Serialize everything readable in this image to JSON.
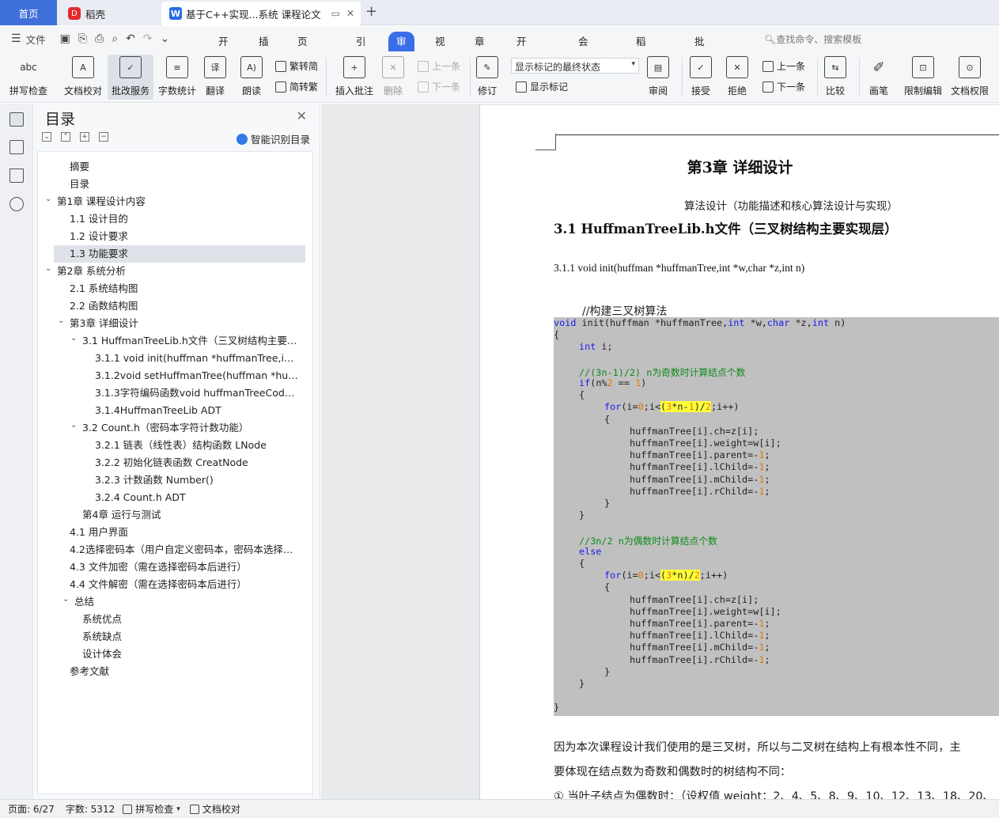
{
  "tabs": {
    "home": "首页",
    "daoke": "稻壳",
    "doc": "基于C++实现...系统 课程论文",
    "new_tab": "+"
  },
  "menu": {
    "file": "文件",
    "items": [
      "开始",
      "插入",
      "页面布局",
      "引用",
      "审阅",
      "视图",
      "章节",
      "开发工具",
      "会员专享",
      "稻壳资源",
      "批改服务"
    ],
    "active": "审阅",
    "search": "查找命令、搜索模板"
  },
  "ribbon": {
    "spell": "拼写检查",
    "doccheck": "文档校对",
    "correct": "批改服务",
    "wordcount": "字数统计",
    "translate": "翻译",
    "read": "朗读",
    "t2s": "繁转简",
    "s2t": "简转繁",
    "insert_comment": "插入批注",
    "delete": "删除",
    "prev_c": "上一条",
    "next_c": "下一条",
    "revise": "修订",
    "markup_state": "显示标记的最终状态",
    "show_markup": "显示标记",
    "review": "审阅",
    "accept": "接受",
    "reject": "拒绝",
    "prev": "上一条",
    "next": "下一条",
    "compare": "比较",
    "pen": "画笔",
    "restrict": "限制编辑",
    "permission": "文档权限"
  },
  "toc": {
    "title": "目录",
    "smart": "智能识别目录",
    "selected": "1.3 功能要求",
    "items": [
      {
        "text": "摘要",
        "level": 1,
        "caret": ""
      },
      {
        "text": "目录",
        "level": 1,
        "caret": ""
      },
      {
        "text": "第1章 课程设计内容",
        "level": 0,
        "caret": "v"
      },
      {
        "text": "1.1 设计目的",
        "level": 1,
        "caret": ""
      },
      {
        "text": "1.2 设计要求",
        "level": 1,
        "caret": ""
      },
      {
        "text": "1.3 功能要求",
        "level": 1,
        "caret": ""
      },
      {
        "text": "第2章 系统分析",
        "level": 0,
        "caret": "v"
      },
      {
        "text": "2.1 系统结构图",
        "level": 1,
        "caret": ""
      },
      {
        "text": "2.2 函数结构图",
        "level": 1,
        "caret": ""
      },
      {
        "text": "第3章 详细设计",
        "level": 1,
        "caret": "v"
      },
      {
        "text": "3.1 HuffmanTreeLib.h文件（三叉树结构主要实…",
        "level": 2,
        "caret": "v"
      },
      {
        "text": "3.1.1 void init(huffman *huffmanTree,int * …",
        "level": 3,
        "caret": ""
      },
      {
        "text": "3.1.2void setHuffmanTree(huffman *huffm…",
        "level": 3,
        "caret": ""
      },
      {
        "text": "3.1.3字符编码函数void huffmanTreeCode(h…",
        "level": 3,
        "caret": ""
      },
      {
        "text": "3.1.4HuffmanTreeLib ADT",
        "level": 3,
        "caret": ""
      },
      {
        "text": "3.2 Count.h（密码本字符计数功能）",
        "level": 2,
        "caret": "v"
      },
      {
        "text": "3.2.1 链表（线性表）结构函数 LNode",
        "level": 3,
        "caret": ""
      },
      {
        "text": "3.2.2 初始化链表函数 CreatNode",
        "level": 3,
        "caret": ""
      },
      {
        "text": "3.2.3 计数函数 Number()",
        "level": 3,
        "caret": ""
      },
      {
        "text": "3.2.4 Count.h ADT",
        "level": 3,
        "caret": ""
      },
      {
        "text": "第4章 运行与测试",
        "level": 2,
        "caret": ""
      },
      {
        "text": "4.1 用户界面",
        "level": 1,
        "caret": ""
      },
      {
        "text": "4.2选择密码本（用户自定义密码本，密码本选择不…",
        "level": 1,
        "caret": ""
      },
      {
        "text": "4.3 文件加密（需在选择密码本后进行）",
        "level": 1,
        "caret": ""
      },
      {
        "text": "4.4 文件解密（需在选择密码本后进行）",
        "level": 1,
        "caret": ""
      },
      {
        "text": "总结",
        "level": 1,
        "caret": "v"
      },
      {
        "text": "系统优点",
        "level": 2,
        "caret": ""
      },
      {
        "text": "系统缺点",
        "level": 2,
        "caret": ""
      },
      {
        "text": "设计体会",
        "level": 2,
        "caret": ""
      },
      {
        "text": "参考文献",
        "level": 1,
        "caret": ""
      }
    ]
  },
  "doc": {
    "chapter": "第3章 详细设计",
    "subtitle": "算法设计（功能描述和核心算法设计与实现）",
    "h2": "3.1 HuffmanTreeLib.h文件（三叉树结构主要实现层）",
    "h3": "3.1.1 void init(huffman *huffmanTree,int *w,char *z,int n)",
    "comment_line": "//构建三叉树算法",
    "code": [
      {
        "i": 0,
        "t": "<span class=\"kw\">void</span> init(huffman *huffmanTree,<span class=\"kw\">int</span> *w,<span class=\"kw\">char</span> *z,<span class=\"kw\">int</span> n)"
      },
      {
        "i": 0,
        "t": "{"
      },
      {
        "i": 1,
        "t": "<span class=\"kw\">int</span> i;"
      },
      {
        "i": 1,
        "t": ""
      },
      {
        "i": 1,
        "t": "<span class=\"cm\">//(3n-1)/2) n为奇数时计算结点个数</span>"
      },
      {
        "i": 1,
        "t": "<span class=\"kw\">if</span>(n%<span class=\"nm\">2</span> == <span class=\"nm\">1</span>)"
      },
      {
        "i": 1,
        "t": "{"
      },
      {
        "i": 2,
        "t": "<span class=\"kw\">for</span>(i=<span class=\"nm\">0</span>;i&lt;<span class=\"hl\">(<span class=\"nm\">3</span>*n-<span class=\"nm\">1</span>)/<span class=\"nm\">2</span></span>;i++)"
      },
      {
        "i": 2,
        "t": "{"
      },
      {
        "i": 3,
        "t": "huffmanTree[i].ch=z[i];"
      },
      {
        "i": 3,
        "t": "huffmanTree[i].weight=w[i];"
      },
      {
        "i": 3,
        "t": "huffmanTree[i].parent=-<span class=\"nm\">1</span>;"
      },
      {
        "i": 3,
        "t": "huffmanTree[i].lChild=-<span class=\"nm\">1</span>;"
      },
      {
        "i": 3,
        "t": "huffmanTree[i].mChild=-<span class=\"nm\">1</span>;"
      },
      {
        "i": 3,
        "t": "huffmanTree[i].rChild=-<span class=\"nm\">1</span>;"
      },
      {
        "i": 2,
        "t": "}"
      },
      {
        "i": 1,
        "t": "}"
      },
      {
        "i": 1,
        "t": ""
      },
      {
        "i": 1,
        "t": "<span class=\"cm\">//3n/2 n为偶数时计算结点个数</span>"
      },
      {
        "i": 1,
        "t": "<span class=\"kw\">else</span>"
      },
      {
        "i": 1,
        "t": "{"
      },
      {
        "i": 2,
        "t": "<span class=\"kw\">for</span>(i=<span class=\"nm\">0</span>;i&lt;<span class=\"hl\">(<span class=\"nm\">3</span>*n)/<span class=\"nm\">2</span></span>;i++)"
      },
      {
        "i": 2,
        "t": "{"
      },
      {
        "i": 3,
        "t": "huffmanTree[i].ch=z[i];"
      },
      {
        "i": 3,
        "t": "huffmanTree[i].weight=w[i];"
      },
      {
        "i": 3,
        "t": "huffmanTree[i].parent=-<span class=\"nm\">1</span>;"
      },
      {
        "i": 3,
        "t": "huffmanTree[i].lChild=-<span class=\"nm\">1</span>;"
      },
      {
        "i": 3,
        "t": "huffmanTree[i].mChild=-<span class=\"nm\">1</span>;"
      },
      {
        "i": 3,
        "t": "huffmanTree[i].rChild=-<span class=\"nm\">1</span>;"
      },
      {
        "i": 2,
        "t": "}"
      },
      {
        "i": 1,
        "t": "}"
      },
      {
        "i": 0,
        "t": ""
      },
      {
        "i": 0,
        "t": "}"
      }
    ],
    "para1": "因为本次课程设计我们使用的是三叉树，所以与二叉树在结构上有根本性不同，主",
    "para2": "要体现在结点数为奇数和偶数时的树结构不同：",
    "para3": "①  当叶子结点为偶数时：（设权值 weight：2、4、5、8、9、10、12、13、18、20、"
  },
  "status": {
    "page": "页面: 6/27",
    "words": "字数: 5312",
    "spell": "拼写检查",
    "proof": "文档校对"
  }
}
